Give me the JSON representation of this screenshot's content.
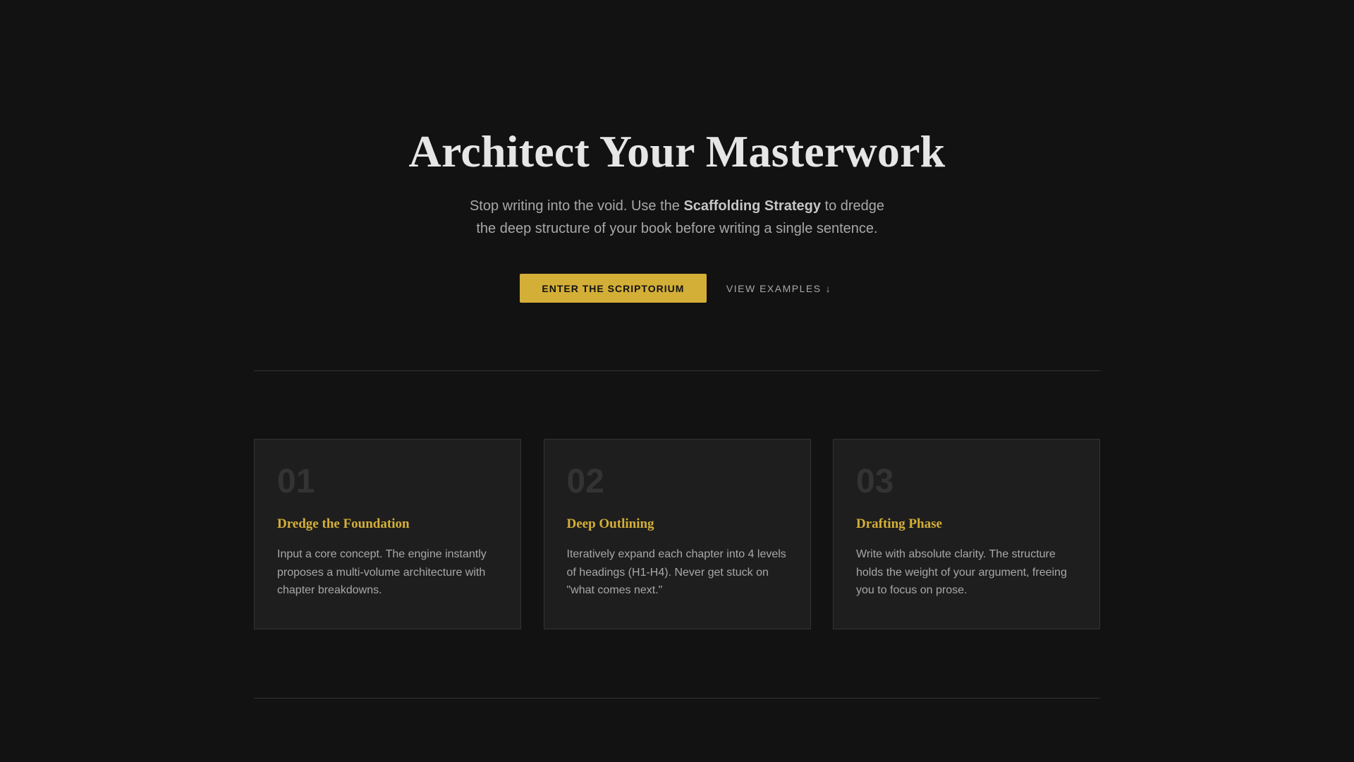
{
  "hero": {
    "title": "Architect Your Masterwork",
    "subtitle_before": "Stop writing into the void. Use the ",
    "subtitle_strong": "Scaffolding Strategy",
    "subtitle_after": " to dredge the deep structure of your book before writing a single sentence.",
    "primary_cta": "ENTER THE SCRIPTORIUM",
    "secondary_cta": "VIEW EXAMPLES",
    "secondary_icon": "↓"
  },
  "features": [
    {
      "number": "01",
      "title": "Dredge the Foundation",
      "description": "Input a core concept. The engine instantly proposes a multi-volume architecture with chapter breakdowns."
    },
    {
      "number": "02",
      "title": "Deep Outlining",
      "description": "Iteratively expand each chapter into 4 levels of headings (H1-H4). Never get stuck on \"what comes next.\""
    },
    {
      "number": "03",
      "title": "Drafting Phase",
      "description": "Write with absolute clarity. The structure holds the weight of your argument, freeing you to focus on prose."
    }
  ],
  "colors": {
    "background": "#121212",
    "surface": "#1e1e1e",
    "accent": "#d4af37",
    "border": "#333333",
    "muted_text": "#a8a8a8"
  },
  "icons": {
    "secondary_cta_icon": "arrow-down-icon"
  }
}
